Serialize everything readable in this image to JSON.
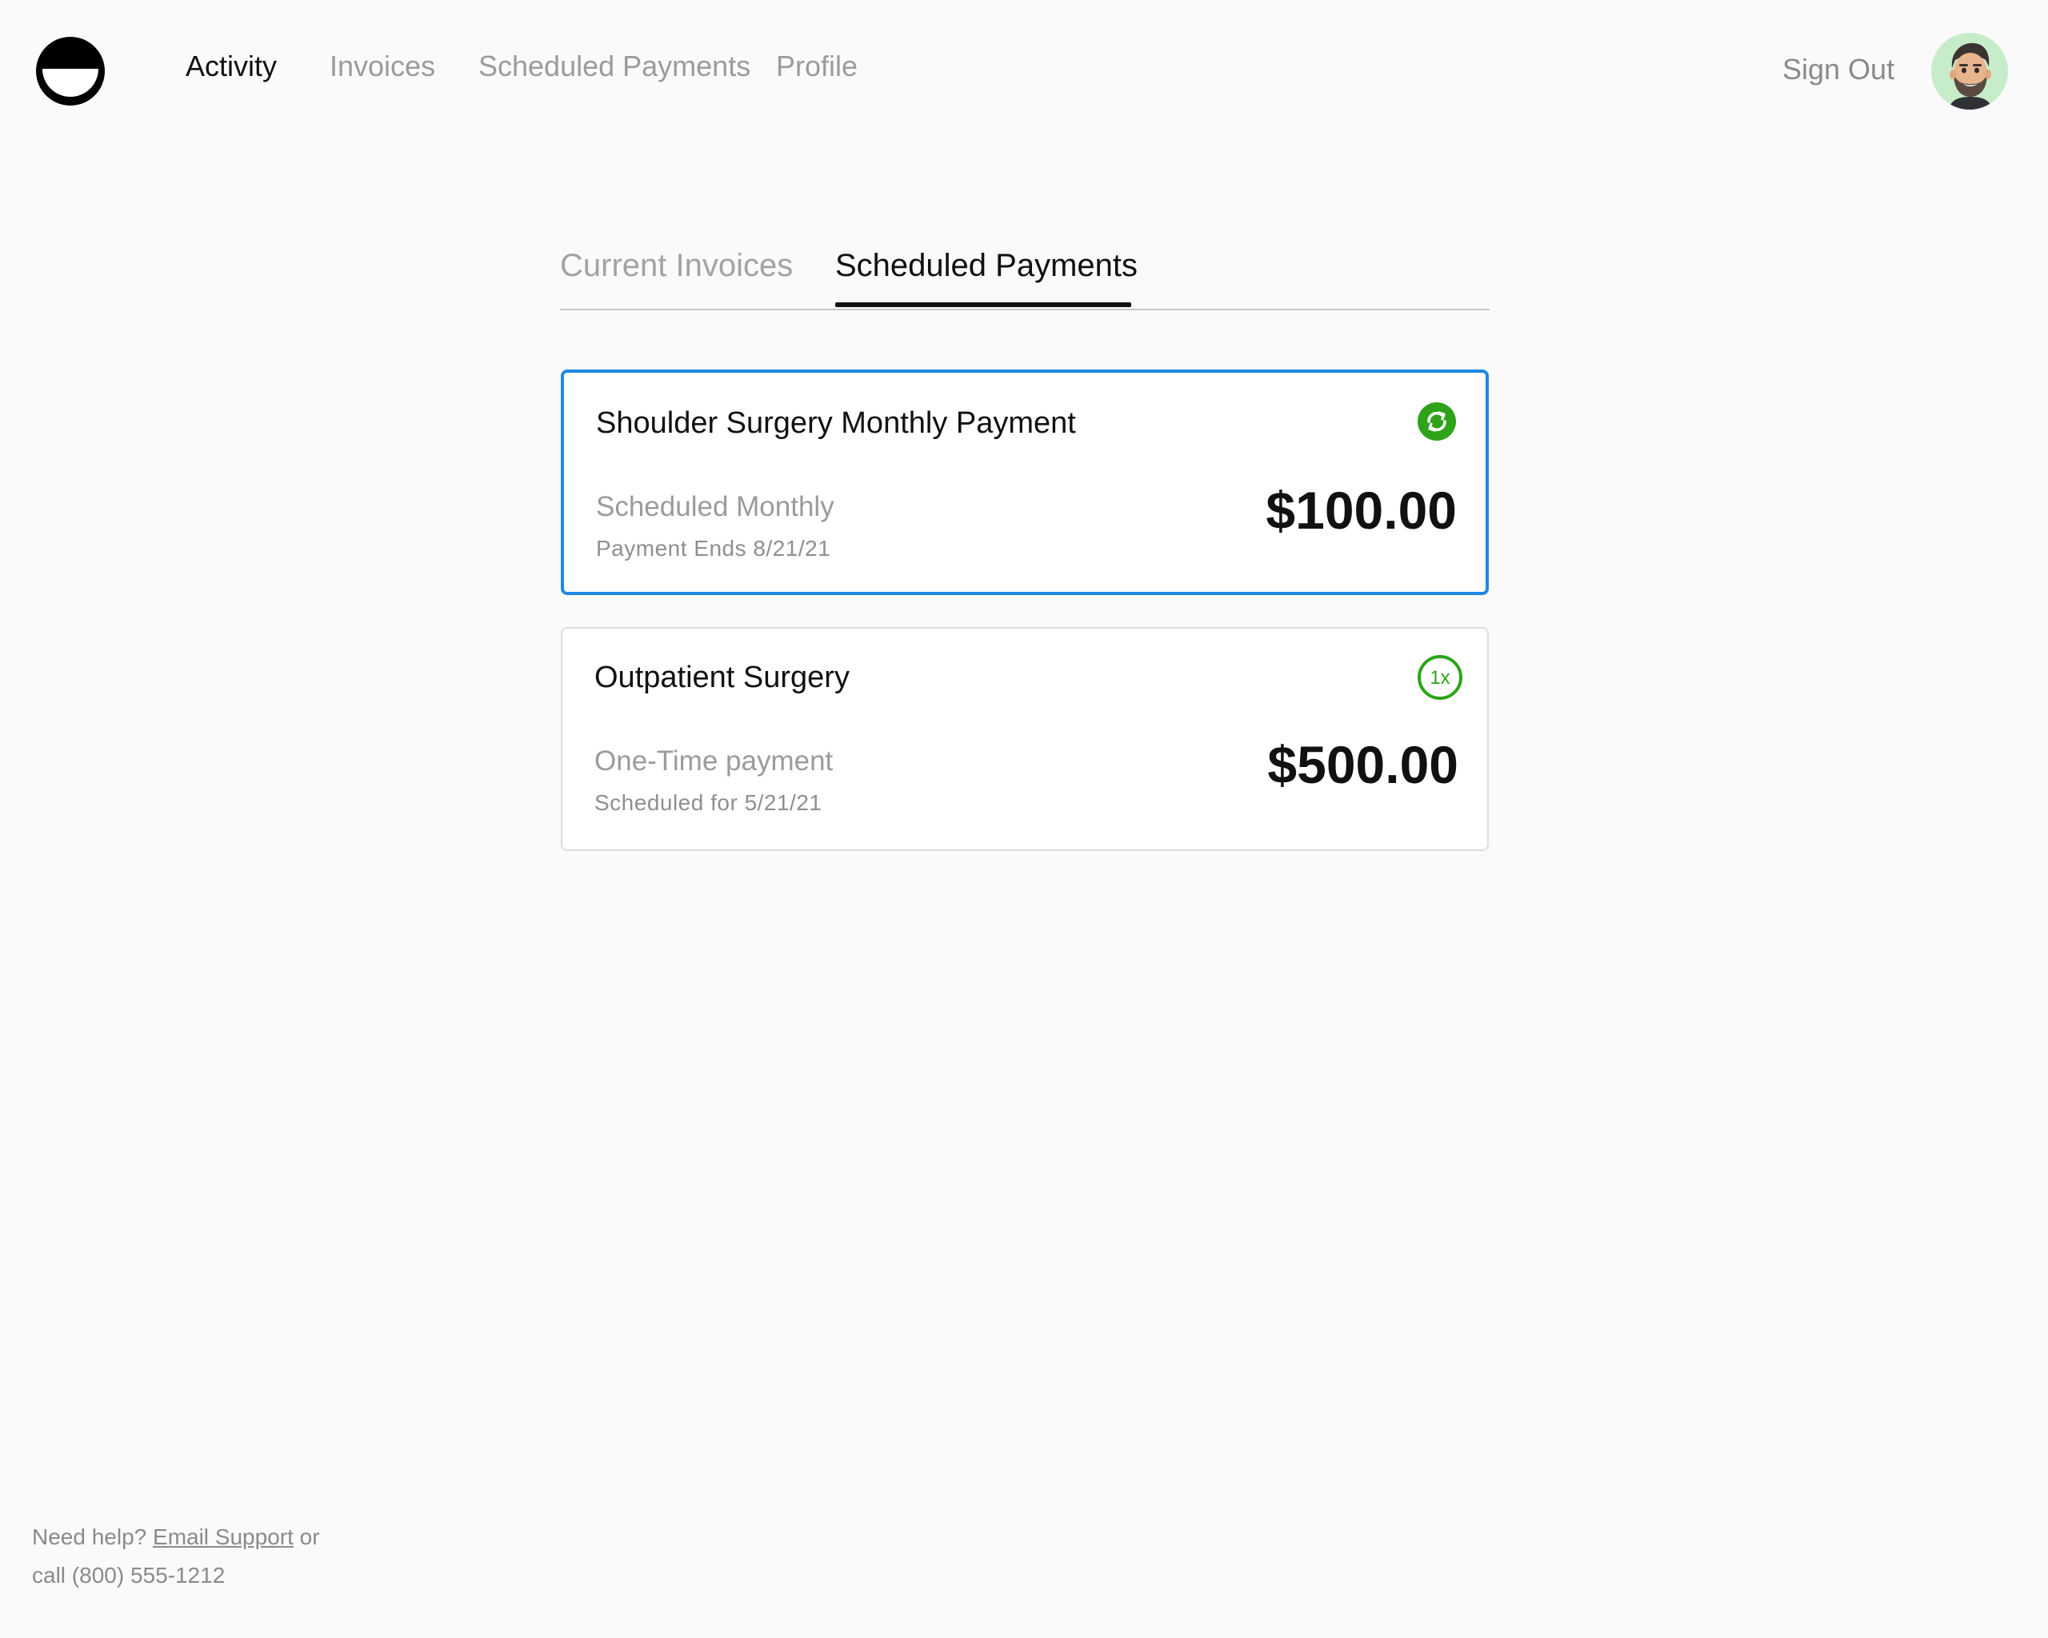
{
  "nav": {
    "items": [
      {
        "label": "Activity",
        "active": true
      },
      {
        "label": "Invoices",
        "active": false
      },
      {
        "label": "Scheduled Payments",
        "active": false
      },
      {
        "label": "Profile",
        "active": false
      }
    ],
    "sign_out": "Sign Out"
  },
  "tabs": [
    {
      "label": "Current Invoices",
      "active": false
    },
    {
      "label": "Scheduled Payments",
      "active": true
    }
  ],
  "payments": [
    {
      "title": "Shoulder Surgery Monthly Payment",
      "type": "Scheduled Monthly",
      "detail": "Payment Ends 8/21/21",
      "amount": "$100.00",
      "icon": "recurring-icon",
      "selected": true
    },
    {
      "title": "Outpatient Surgery",
      "type": "One-Time payment",
      "detail": "Scheduled for 5/21/21",
      "amount": "$500.00",
      "icon": "one-time-icon",
      "icon_text": "1x",
      "selected": false
    }
  ],
  "footer": {
    "help_prefix": "Need help?",
    "email_link": "Email Support",
    "or": "or",
    "call": "call (800) 555-1212"
  },
  "colors": {
    "accent": "#1e88e5",
    "success": "#2ea31a",
    "muted": "#9b9b9b",
    "avatar_bg": "#c6ecc9"
  }
}
